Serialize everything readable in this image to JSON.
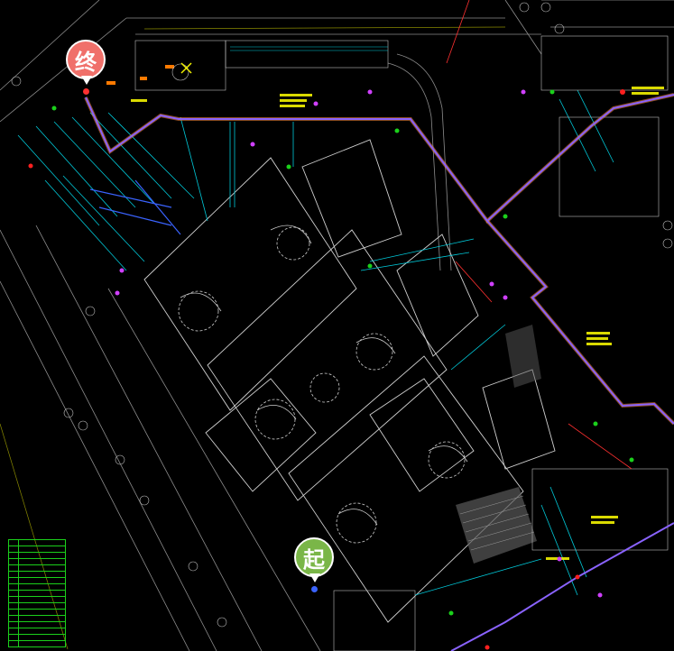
{
  "map": {
    "background": "#000000",
    "route_color": "#8a63ff",
    "route_outline_color": "#ff8a3d",
    "pipe_color": "#00c8d8",
    "linework_color": "#c8c8c8",
    "label_color": "#f2f200"
  },
  "markers": {
    "end": {
      "label": "终",
      "color": "#f0706a",
      "icon": "end-pin-icon"
    },
    "start": {
      "label": "起",
      "color": "#7ab648",
      "icon": "start-pin-icon"
    }
  },
  "legend": {
    "border_color": "#1bd01b",
    "rows": [
      "",
      "",
      "",
      "",
      "",
      "",
      "",
      "",
      "",
      "",
      "",
      "",
      "",
      "",
      "",
      "",
      ""
    ]
  }
}
